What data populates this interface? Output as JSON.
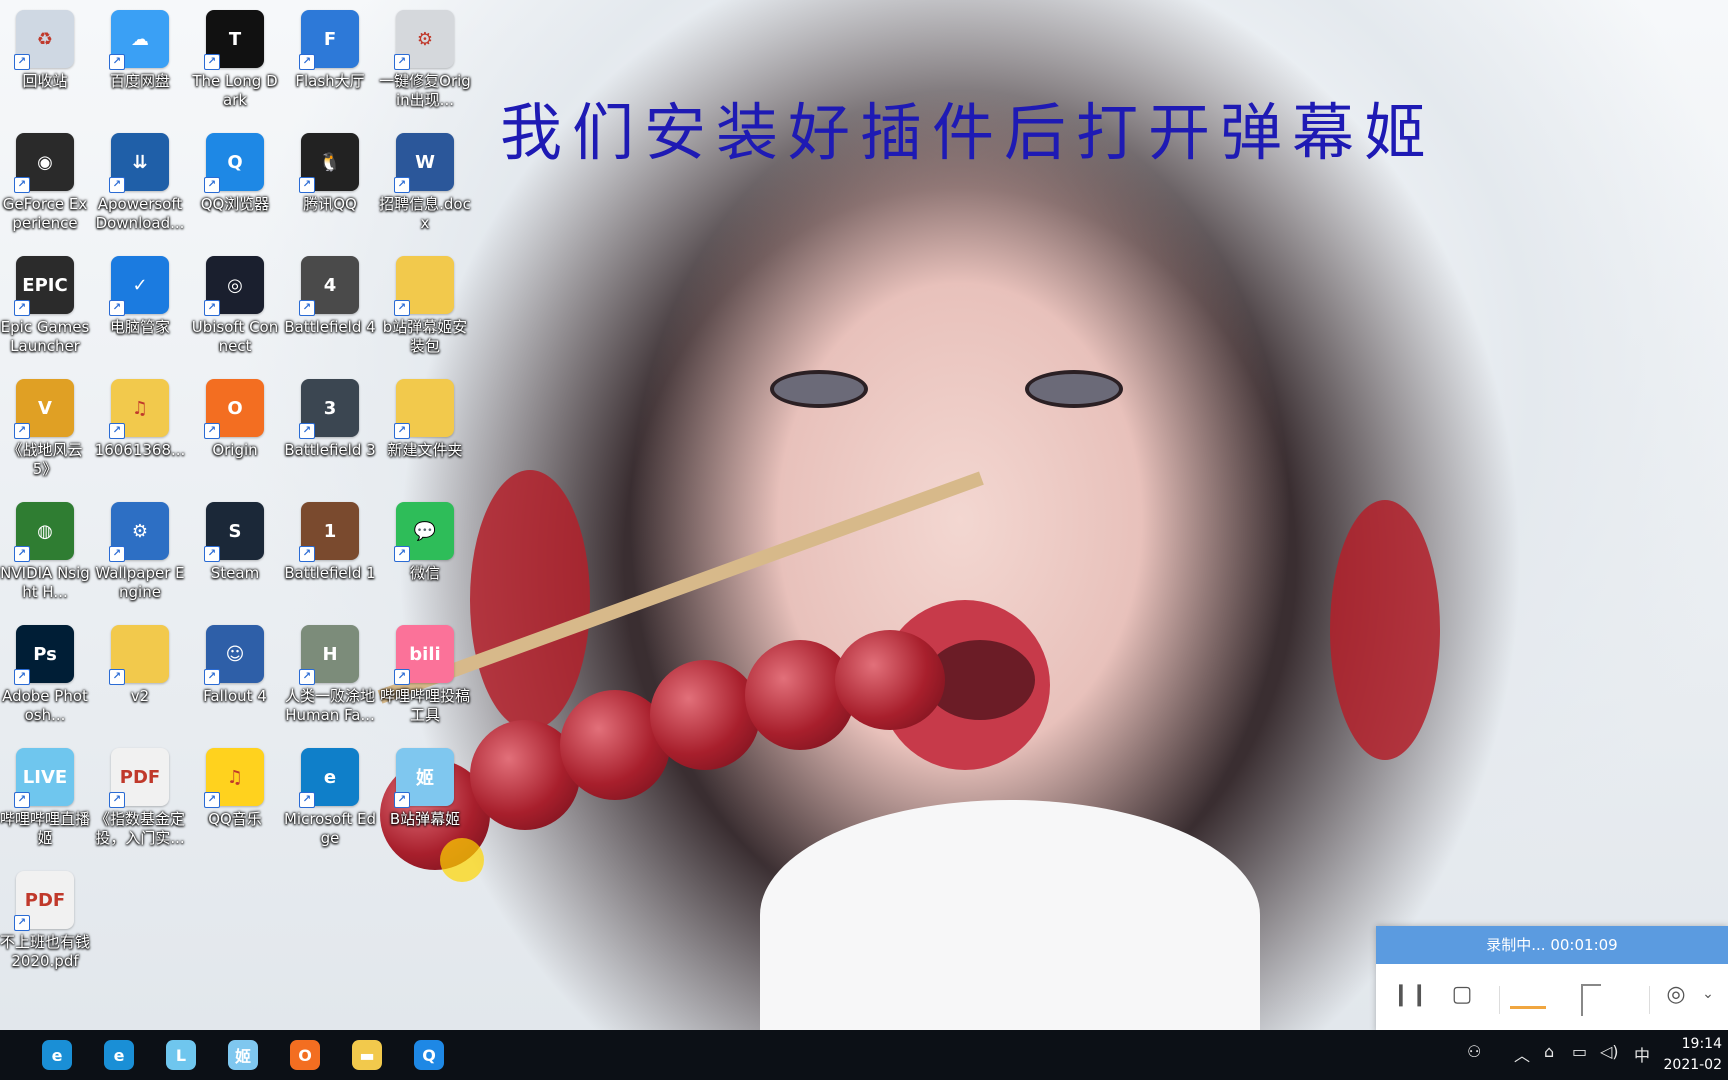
{
  "overlay_title": "我们安装好插件后打开弹幕姬",
  "desktop_icons": [
    {
      "label": "回收站",
      "icon": "recycle-bin-icon",
      "color": "#cfd8e3",
      "glyph": "♻"
    },
    {
      "label": "百度网盘",
      "icon": "baidu-netdisk-icon",
      "color": "#3aa0f5",
      "glyph": "☁"
    },
    {
      "label": "The Long Dark",
      "icon": "the-long-dark-icon",
      "color": "#111111",
      "glyph": "T"
    },
    {
      "label": "Flash大厅",
      "icon": "flash-hall-icon",
      "color": "#2d79d8",
      "glyph": "F"
    },
    {
      "label": "一键修复Origin出现...",
      "icon": "shortcut-settings-icon",
      "color": "#d5d8dc",
      "glyph": "⚙"
    },
    {
      "label": "GeForce Experience",
      "icon": "geforce-icon",
      "color": "#2a2a2a",
      "glyph": "◉"
    },
    {
      "label": "Apowersoft Download...",
      "icon": "apowersoft-icon",
      "color": "#1f5fa8",
      "glyph": "⇊"
    },
    {
      "label": "QQ浏览器",
      "icon": "qq-browser-icon",
      "color": "#1e88e5",
      "glyph": "Q"
    },
    {
      "label": "腾讯QQ",
      "icon": "tencent-qq-icon",
      "color": "#222222",
      "glyph": "🐧"
    },
    {
      "label": "招聘信息.docx",
      "icon": "word-document-icon",
      "color": "#2b579a",
      "glyph": "W"
    },
    {
      "label": "Epic Games Launcher",
      "icon": "epic-games-icon",
      "color": "#2b2b2b",
      "glyph": "EPIC"
    },
    {
      "label": "电脑管家",
      "icon": "pc-manager-icon",
      "color": "#1b7be0",
      "glyph": "✓"
    },
    {
      "label": "Ubisoft Connect",
      "icon": "ubisoft-icon",
      "color": "#1a1f2e",
      "glyph": "◎"
    },
    {
      "label": "Battlefield 4",
      "icon": "battlefield-4-icon",
      "color": "#4a4a4a",
      "glyph": "4"
    },
    {
      "label": "b站弹幕姬安装包",
      "icon": "folder-icon",
      "color": "#f2c94c",
      "glyph": ""
    },
    {
      "label": "《战地风云 5》",
      "icon": "battlefield-5-icon",
      "color": "#e0a024",
      "glyph": "V"
    },
    {
      "label": "16061368...",
      "icon": "music-folder-icon",
      "color": "#f2c94c",
      "glyph": "♫"
    },
    {
      "label": "Origin",
      "icon": "origin-icon",
      "color": "#f36e21",
      "glyph": "O"
    },
    {
      "label": "Battlefield 3",
      "icon": "battlefield-3-icon",
      "color": "#3b4651",
      "glyph": "3"
    },
    {
      "label": "新建文件夹",
      "icon": "folder-icon",
      "color": "#f2c94c",
      "glyph": ""
    },
    {
      "label": "NVIDIA Nsight H...",
      "icon": "nvidia-nsight-icon",
      "color": "#2f7d32",
      "glyph": "◍"
    },
    {
      "label": "Wallpaper Engine",
      "icon": "wallpaper-engine-icon",
      "color": "#2d6fc4",
      "glyph": "⚙"
    },
    {
      "label": "Steam",
      "icon": "steam-icon",
      "color": "#1b2838",
      "glyph": "S"
    },
    {
      "label": "Battlefield 1",
      "icon": "battlefield-1-icon",
      "color": "#7a4a2e",
      "glyph": "1"
    },
    {
      "label": "微信",
      "icon": "wechat-icon",
      "color": "#2ebd59",
      "glyph": "💬"
    },
    {
      "label": "Adobe Photosh...",
      "icon": "photoshop-icon",
      "color": "#001e36",
      "glyph": "Ps"
    },
    {
      "label": "v2",
      "icon": "folder-icon",
      "color": "#f2c94c",
      "glyph": ""
    },
    {
      "label": "Fallout 4",
      "icon": "fallout-4-icon",
      "color": "#2e5fa8",
      "glyph": "☺"
    },
    {
      "label": "人类一败涂地 Human Fa...",
      "icon": "human-fall-flat-icon",
      "color": "#7c8c7a",
      "glyph": "H"
    },
    {
      "label": "哔哩哔哩投稿工具",
      "icon": "bilibili-upload-icon",
      "color": "#fb7299",
      "glyph": "bili"
    },
    {
      "label": "哔哩哔哩直播姬",
      "icon": "bilibili-live-icon",
      "color": "#6fc6ee",
      "glyph": "LIVE"
    },
    {
      "label": "《指数基金定投，入门实...",
      "icon": "pdf-file-icon",
      "color": "#f1f1f1",
      "glyph": "PDF"
    },
    {
      "label": "QQ音乐",
      "icon": "qq-music-icon",
      "color": "#ffd21e",
      "glyph": "♫"
    },
    {
      "label": "Microsoft Edge",
      "icon": "edge-icon",
      "color": "#0f7fc9",
      "glyph": "e"
    },
    {
      "label": "B站弹幕姬",
      "icon": "danmaku-ji-icon",
      "color": "#7fc7ef",
      "glyph": "姬"
    },
    {
      "label": "不上班也有钱2020.pdf",
      "icon": "pdf-file-icon",
      "color": "#f1f1f1",
      "glyph": "PDF"
    }
  ],
  "recorder": {
    "status": "录制中... 00:01:09",
    "pause_glyph": "❙❙",
    "stop_glyph": "▢",
    "webcam_glyph": "◎",
    "dropdown_glyph": "⌄"
  },
  "taskbar": {
    "apps": [
      {
        "name": "taskbar-edge",
        "icon": "edge-icon",
        "color": "#1a8fd6",
        "glyph": "e"
      },
      {
        "name": "taskbar-edge-2",
        "icon": "edge-icon",
        "color": "#1a8fd6",
        "glyph": "e"
      },
      {
        "name": "taskbar-bilibili-live",
        "icon": "bilibili-live-icon",
        "color": "#6fc6ee",
        "glyph": "L"
      },
      {
        "name": "taskbar-danmaku-ji",
        "icon": "danmaku-ji-icon",
        "color": "#7fc7ef",
        "glyph": "姬"
      },
      {
        "name": "taskbar-origin",
        "icon": "origin-icon",
        "color": "#f36e21",
        "glyph": "O"
      },
      {
        "name": "taskbar-file-explorer",
        "icon": "folder-icon",
        "color": "#f2c94c",
        "glyph": "▬"
      },
      {
        "name": "taskbar-qq-browser",
        "icon": "qq-browser-icon",
        "color": "#1e88e5",
        "glyph": "Q"
      }
    ],
    "tray": {
      "people": "⚇",
      "chevron": "︿",
      "network": "⌂",
      "monitor": "▭",
      "volume": "◁)",
      "ime": "中"
    },
    "time": "19:14",
    "date": "2021-02"
  }
}
